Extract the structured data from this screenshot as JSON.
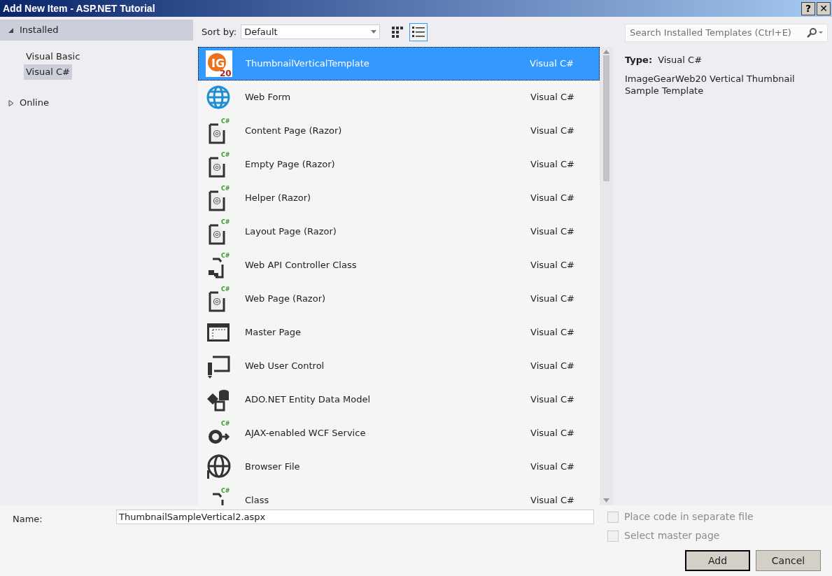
{
  "window": {
    "title": "Add New Item - ASP.NET Tutorial",
    "buttons": [
      "?",
      "✕"
    ]
  },
  "sidebar": {
    "items": [
      {
        "label": "Installed",
        "expanded": true,
        "selected": true,
        "children": [
          {
            "label": "Visual Basic",
            "selected": false
          },
          {
            "label": "Visual C#",
            "selected": true
          }
        ]
      },
      {
        "label": "Online",
        "expanded": false,
        "selected": false
      }
    ]
  },
  "toolbar": {
    "sort_label": "Sort by:",
    "sort_value": "Default",
    "views": [
      {
        "kind": "grid",
        "selected": false
      },
      {
        "kind": "list",
        "selected": true
      }
    ]
  },
  "search": {
    "placeholder": "Search Installed Templates (Ctrl+E)"
  },
  "templates": [
    {
      "name": "ThumbnailVerticalTemplate",
      "type": "Visual C#",
      "kind": "ig",
      "logo": "IG",
      "badge": "20",
      "selected": true
    },
    {
      "name": "Web Form",
      "type": "Visual C#",
      "kind": "globe",
      "selected": false
    },
    {
      "name": "Content Page (Razor)",
      "type": "Visual C#",
      "kind": "razor",
      "badge": "C#",
      "selected": false
    },
    {
      "name": "Empty Page (Razor)",
      "type": "Visual C#",
      "kind": "razor",
      "badge": "C#",
      "selected": false
    },
    {
      "name": "Helper (Razor)",
      "type": "Visual C#",
      "kind": "razor",
      "badge": "C#",
      "selected": false
    },
    {
      "name": "Layout Page (Razor)",
      "type": "Visual C#",
      "kind": "razor",
      "badge": "C#",
      "selected": false
    },
    {
      "name": "Web API Controller Class",
      "type": "Visual C#",
      "kind": "api",
      "badge": "C#",
      "selected": false
    },
    {
      "name": "Web Page (Razor)",
      "type": "Visual C#",
      "kind": "razor",
      "badge": "C#",
      "selected": false
    },
    {
      "name": "Master Page",
      "type": "Visual C#",
      "kind": "master",
      "selected": false
    },
    {
      "name": "Web User Control",
      "type": "Visual C#",
      "kind": "usercontrol",
      "selected": false
    },
    {
      "name": "ADO.NET Entity Data Model",
      "type": "Visual C#",
      "kind": "ado",
      "selected": false
    },
    {
      "name": "AJAX-enabled WCF Service",
      "type": "Visual C#",
      "kind": "wcf",
      "badge": "C#",
      "selected": false
    },
    {
      "name": "Browser File",
      "type": "Visual C#",
      "kind": "browser",
      "selected": false
    },
    {
      "name": "Class",
      "type": "Visual C#",
      "kind": "api",
      "badge": "C#",
      "selected": false
    }
  ],
  "details": {
    "type_label": "Type:",
    "type_value": "Visual C#",
    "description": "ImageGearWeb20 Vertical Thumbnail Sample Template"
  },
  "name_field": {
    "label": "Name:",
    "value": "ThumbnailSampleVertical2.aspx"
  },
  "options": [
    {
      "label": "Place code in separate file",
      "checked": false,
      "disabled": true
    },
    {
      "label": "Select master page",
      "checked": false,
      "disabled": true
    }
  ],
  "buttons": [
    {
      "label": "Add",
      "default": true
    },
    {
      "label": "Cancel",
      "default": false
    }
  ]
}
